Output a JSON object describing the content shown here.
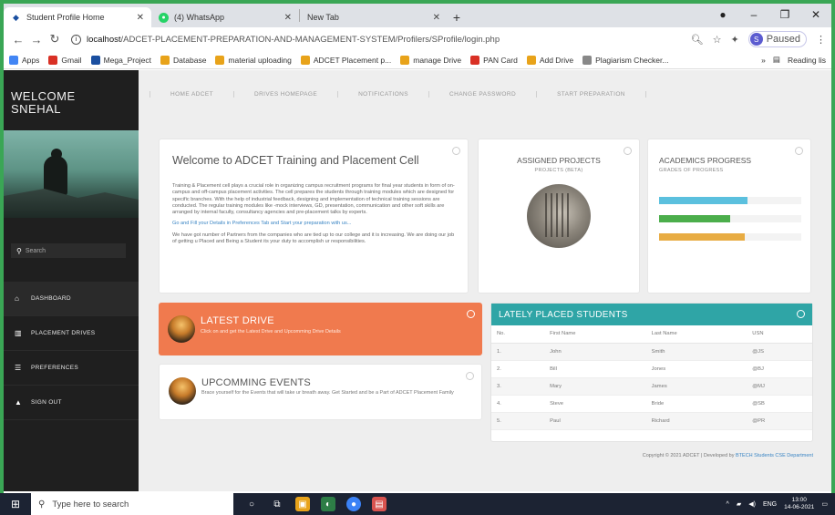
{
  "browser": {
    "tabs": [
      {
        "title": "Student Profile Home",
        "icon": "student-favicon",
        "active": true
      },
      {
        "title": "(4) WhatsApp",
        "icon": "whatsapp-favicon",
        "active": false
      },
      {
        "title": "New Tab",
        "icon": "",
        "active": false
      }
    ],
    "url_host": "localhost",
    "url_path": "/ADCET-PLACEMENT-PREPARATION-AND-MANAGEMENT-SYSTEM/Profilers/SProfile/login.php",
    "paused_label": "Paused",
    "profile_initial": "S",
    "bookmarks": [
      {
        "label": "Apps",
        "color": "#4285f4"
      },
      {
        "label": "Gmail",
        "color": "#d93025"
      },
      {
        "label": "Mega_Project",
        "color": "#1a4fa0"
      },
      {
        "label": "Database",
        "color": "#e8a31a"
      },
      {
        "label": "material uploading",
        "color": "#e8a31a"
      },
      {
        "label": "ADCET Placement p...",
        "color": "#e8a31a"
      },
      {
        "label": "manage Drive",
        "color": "#e8a31a"
      },
      {
        "label": "PAN Card",
        "color": "#d93025"
      },
      {
        "label": "Add Drive",
        "color": "#e8a31a"
      },
      {
        "label": "Plagiarism Checker...",
        "color": "#888888"
      }
    ],
    "reading_list": "Reading lis"
  },
  "sidebar": {
    "welcome_line1": "WELCOME",
    "welcome_line2": "SNEHAL",
    "search_placeholder": "Search",
    "items": [
      {
        "label": "DASHBOARD",
        "icon": "home-icon"
      },
      {
        "label": "PLACEMENT DRIVES",
        "icon": "chart-icon"
      },
      {
        "label": "PREFERENCES",
        "icon": "list-icon"
      },
      {
        "label": "SIGN OUT",
        "icon": "user-icon"
      }
    ]
  },
  "topnav": [
    "HOME ADCET",
    "DRIVES HOMEPAGE",
    "NOTIFICATIONS",
    "CHANGE PASSWORD",
    "START PREPARATION"
  ],
  "welcome_card": {
    "title": "Welcome to ADCET Training and Placement Cell",
    "para1": "Training & Placement cell plays a crucial role in organizing campus recruitment programs for final year students in form of on-campus and off-campus placement activities. The cell prepares the students through training modules which are designed for specific branches. With the help of industrial feedback, designing and implementation of technical training sessions are conducted. The regular training modules like -mock interviews, GD, presentation, communication and other soft skills are arranged by internal faculty, consultancy agencies and pre-placement talks by experts.",
    "link": "Go and Fill your Details in Preferences Tab and Start your preparation with us...",
    "para2": "We have got number of Partners from the companies who are tied up to our college and it is increasing. We are doing our job of getting u Placed and Being a Student its your duty to accomplish ur responsibilities."
  },
  "assigned": {
    "title": "ASSIGNED PROJECTS",
    "subtitle": "PROJECTS (BETA)"
  },
  "academics": {
    "title": "ACADEMICS PROGRESS",
    "subtitle": "GRADES OF PROGRESS",
    "bars": [
      {
        "value": 0.62,
        "color": "#5bc0de"
      },
      {
        "value": 0.5,
        "color": "#4cae4c"
      },
      {
        "value": 0.6,
        "color": "#e8ac43"
      }
    ]
  },
  "latest_drive": {
    "title": "LATEST DRIVE",
    "subtitle": "Click on and get the Latest Drive and Upcomming Drive Details"
  },
  "events": {
    "title": "UPCOMMING EVENTS",
    "subtitle": "Brace yourself for the Events that will take ur breath away. Get Started and be a Part of ADCET Placement Family"
  },
  "placed": {
    "title": "LATELY PLACED STUDENTS",
    "headers": [
      "No.",
      "First Name",
      "Last Name",
      "USN"
    ],
    "rows": [
      [
        "1.",
        "John",
        "Smith",
        "@JS"
      ],
      [
        "2.",
        "Bill",
        "Jones",
        "@BJ"
      ],
      [
        "3.",
        "Mary",
        "James",
        "@MJ"
      ],
      [
        "4.",
        "Steve",
        "Bride",
        "@SB"
      ],
      [
        "5.",
        "Paul",
        "Richard",
        "@PR"
      ]
    ]
  },
  "footer": {
    "text": "Copyright © 2021 ADCET | Developed by ",
    "link": "BTECH Students CSE Department"
  },
  "taskbar": {
    "search_placeholder": "Type here to search",
    "lang": "ENG",
    "time": "13:00",
    "date": "14-06-2021"
  }
}
